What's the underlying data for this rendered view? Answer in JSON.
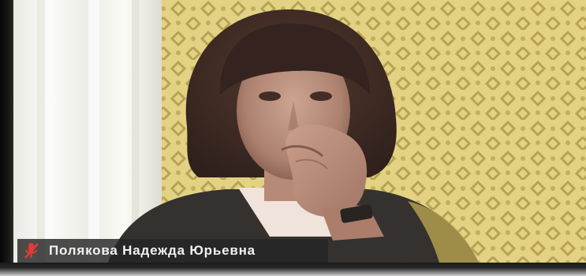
{
  "participant": {
    "name": "Полякова  Надежда Юрьевна",
    "mic_state": "muted",
    "mic_icon": "mic-muted-icon",
    "mic_color": "#e53935"
  },
  "colors": {
    "wallpaper": "#d8c36b",
    "curtain": "#f3f3ef",
    "name_bar": "#262626"
  }
}
